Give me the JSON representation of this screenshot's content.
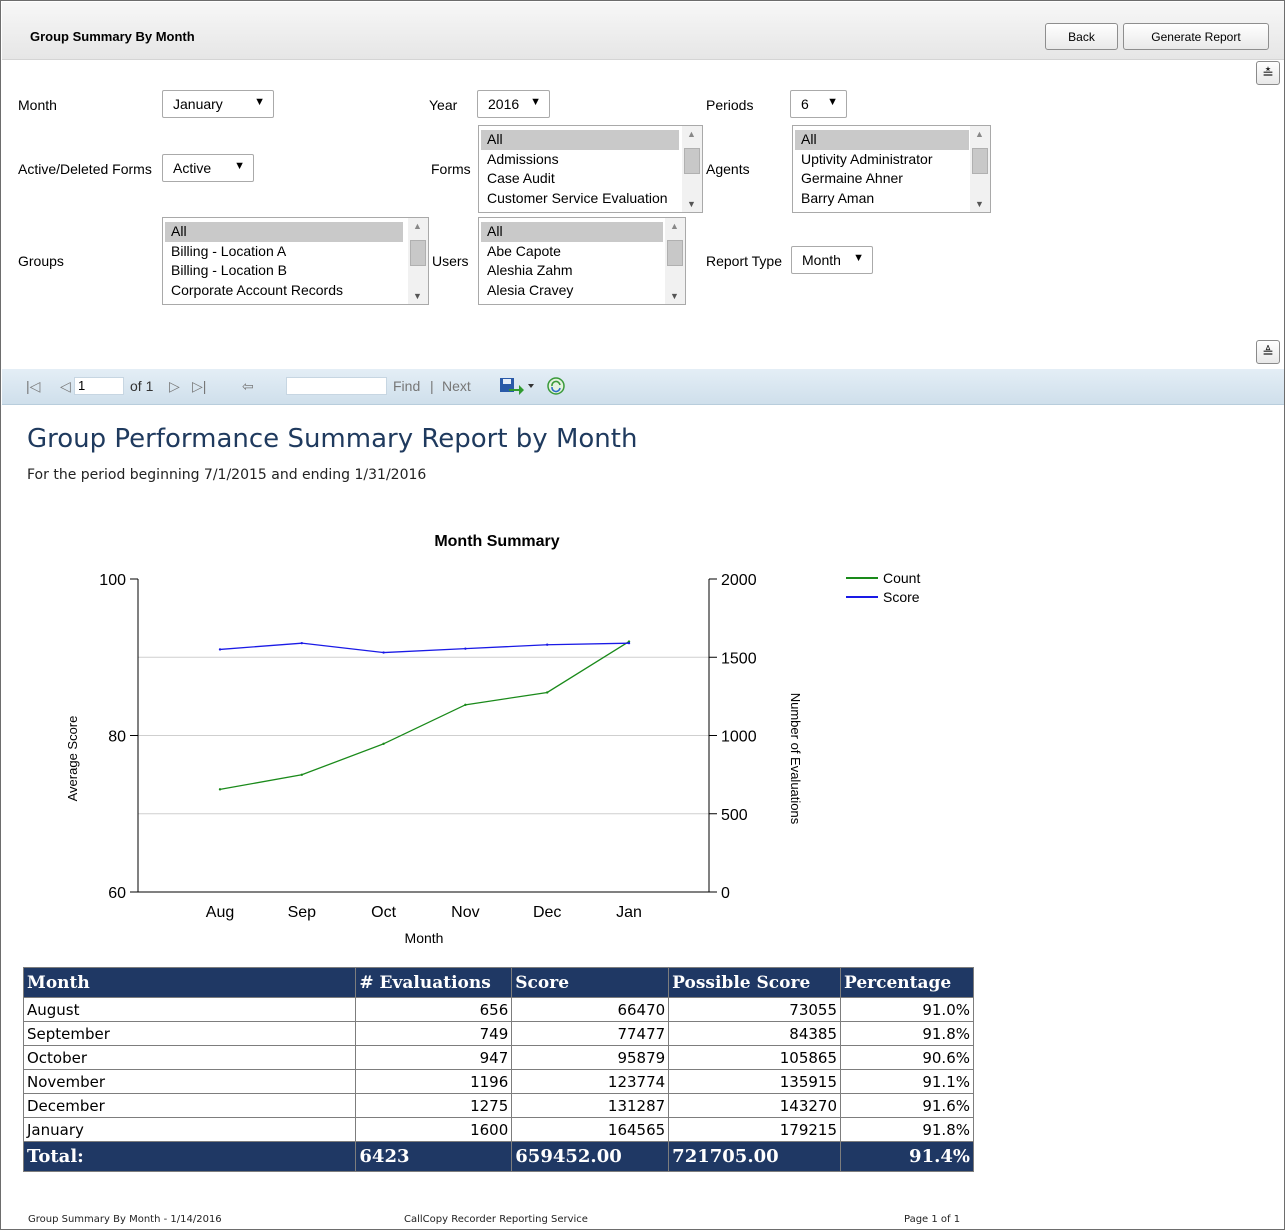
{
  "header": {
    "title": "Group Summary By Month",
    "back_label": "Back",
    "generate_label": "Generate Report"
  },
  "params": {
    "month_label": "Month",
    "month_value": "January",
    "year_label": "Year",
    "year_value": "2016",
    "periods_label": "Periods",
    "periods_value": "6",
    "active_label": "Active/Deleted Forms",
    "active_value": "Active",
    "forms_label": "Forms",
    "forms_options": [
      "All",
      "Admissions",
      "Case Audit",
      "Customer Service Evaluation"
    ],
    "agents_label": "Agents",
    "agents_options": [
      "All",
      "Uptivity Administrator",
      "Germaine Ahner",
      "Barry Aman"
    ],
    "groups_label": "Groups",
    "groups_options": [
      "All",
      "Billing - Location A",
      "Billing - Location B",
      "Corporate Account Records"
    ],
    "users_label": "Users",
    "users_options": [
      "All",
      "Abe Capote",
      "Aleshia Zahm",
      "Alesia Cravey"
    ],
    "report_type_label": "Report Type",
    "report_type_value": "Month"
  },
  "toolbar": {
    "page_value": "1",
    "of_label": "of 1",
    "find_label": "Find",
    "separator": "|",
    "next_label": "Next"
  },
  "report": {
    "title": "Group Performance Summary Report by Month",
    "subtitle": "For the period beginning 7/1/2015 and ending 1/31/2016"
  },
  "chart_data": {
    "type": "line",
    "title": "Month Summary",
    "xlabel": "Month",
    "ylabel": "Average Score",
    "y2label": "Number of Evaluations",
    "categories": [
      "Aug",
      "Sep",
      "Oct",
      "Nov",
      "Dec",
      "Jan"
    ],
    "ylim": [
      60,
      100
    ],
    "y2lim": [
      0,
      2000
    ],
    "yticks": [
      60,
      80,
      100
    ],
    "y2ticks": [
      0,
      500,
      1000,
      1500,
      2000
    ],
    "legend_position": "top-right",
    "series": [
      {
        "name": "Count",
        "axis": "right",
        "color": "#1a8a1a",
        "values": [
          656,
          749,
          947,
          1196,
          1275,
          1600
        ]
      },
      {
        "name": "Score",
        "axis": "left",
        "color": "#1a1ae6",
        "values": [
          91.0,
          91.8,
          90.6,
          91.1,
          91.6,
          91.8
        ]
      }
    ]
  },
  "table": {
    "headers": [
      "Month",
      "# Evaluations",
      "Score",
      "Possible Score",
      "Percentage"
    ],
    "rows": [
      [
        "August",
        "656",
        "66470",
        "73055",
        "91.0%"
      ],
      [
        "September",
        "749",
        "77477",
        "84385",
        "91.8%"
      ],
      [
        "October",
        "947",
        "95879",
        "105865",
        "90.6%"
      ],
      [
        "November",
        "1196",
        "123774",
        "135915",
        "91.1%"
      ],
      [
        "December",
        "1275",
        "131287",
        "143270",
        "91.6%"
      ],
      [
        "January",
        "1600",
        "164565",
        "179215",
        "91.8%"
      ]
    ],
    "total": [
      "Total:",
      "6423",
      "659452.00",
      "721705.00",
      "91.4%"
    ]
  },
  "footer": {
    "left": "Group Summary By Month - 1/14/2016",
    "center": "CallCopy Recorder Reporting Service",
    "right": "Page 1 of 1"
  }
}
